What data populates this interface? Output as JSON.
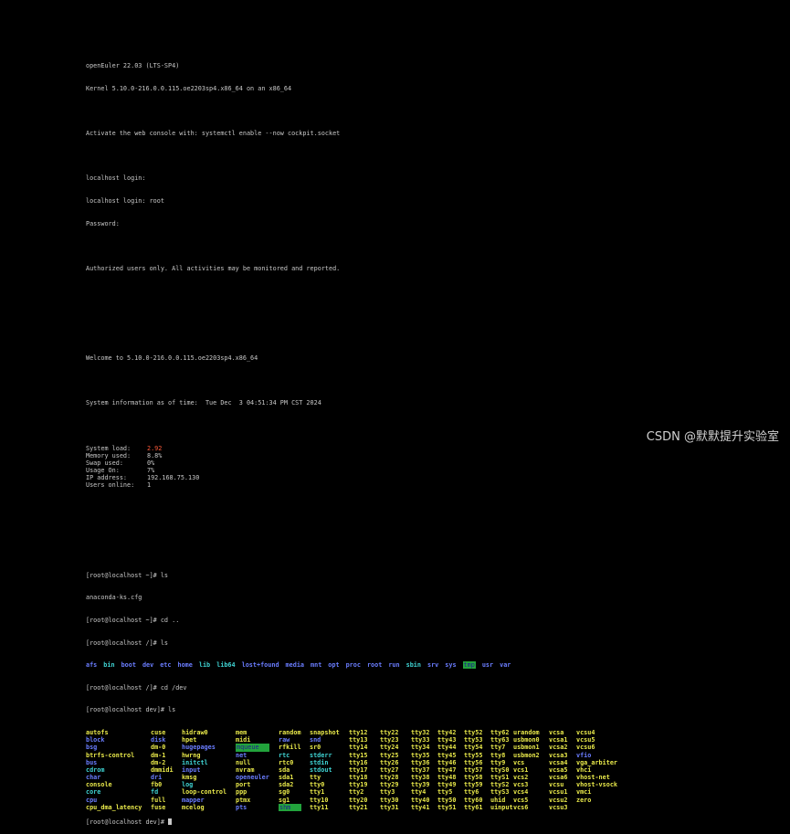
{
  "colors": {
    "default": "#c8c8c8",
    "dir": "#6a7dff",
    "cyan": "#3fd3d3",
    "yellow": "#e8e84a",
    "red": "#ff5a3a",
    "highlight_bg": "#22a33c",
    "highlight_fg": "#1f1f8f"
  },
  "header": [
    "openEuler 22.03 (LTS-SP4)",
    "Kernel 5.10.0-216.0.0.115.oe2203sp4.x86_64 on an x86_64"
  ],
  "cockpit_msg": "Activate the web console with: systemctl enable --now cockpit.socket",
  "login_lines": [
    "localhost login:",
    "localhost login: root",
    "Password:"
  ],
  "auth_msg": "Authorized users only. All activities may be monitored and reported.",
  "welcome_msg": "Welcome to 5.10.0-216.0.0.115.oe2203sp4.x86_64",
  "sysinfo_time": "System information as of time:  Tue Dec  3 04:51:34 PM CST 2024",
  "stats": [
    {
      "label": "System load:",
      "value": "2.92",
      "alert": true
    },
    {
      "label": "Memory used:",
      "value": "8.8%",
      "alert": false
    },
    {
      "label": "Swap used:",
      "value": "0%",
      "alert": false
    },
    {
      "label": "Usage On:",
      "value": "7%",
      "alert": false
    },
    {
      "label": "IP address:",
      "value": "192.168.75.130",
      "alert": false
    },
    {
      "label": "Users online:",
      "value": "1",
      "alert": false
    }
  ],
  "session": [
    {
      "text": "[root@localhost ~]# ls"
    },
    {
      "text": "anaconda-ks.cfg"
    },
    {
      "text": "[root@localhost ~]# cd .."
    },
    {
      "text": "[root@localhost /]# ls"
    }
  ],
  "ls_root": [
    {
      "name": "afs",
      "style": "dir"
    },
    {
      "name": "bin",
      "style": "cyan"
    },
    {
      "name": "boot",
      "style": "dir"
    },
    {
      "name": "dev",
      "style": "dir"
    },
    {
      "name": "etc",
      "style": "dir"
    },
    {
      "name": "home",
      "style": "dir"
    },
    {
      "name": "lib",
      "style": "cyan"
    },
    {
      "name": "lib64",
      "style": "cyan"
    },
    {
      "name": "lost+found",
      "style": "dir"
    },
    {
      "name": "media",
      "style": "dir"
    },
    {
      "name": "mnt",
      "style": "dir"
    },
    {
      "name": "opt",
      "style": "dir"
    },
    {
      "name": "proc",
      "style": "dir"
    },
    {
      "name": "root",
      "style": "dir"
    },
    {
      "name": "run",
      "style": "dir"
    },
    {
      "name": "sbin",
      "style": "cyan"
    },
    {
      "name": "srv",
      "style": "dir"
    },
    {
      "name": "sys",
      "style": "dir"
    },
    {
      "name": "tmp",
      "style": "highlight"
    },
    {
      "name": "usr",
      "style": "dir"
    },
    {
      "name": "var",
      "style": "dir"
    }
  ],
  "cd_dev": "[root@localhost /]# cd /dev",
  "ls_dev_cmd": "[root@localhost dev]# ls",
  "ls_dev": [
    [
      {
        "name": "autofs",
        "style": "yellow"
      },
      {
        "name": "block",
        "style": "dir"
      },
      {
        "name": "bsg",
        "style": "dir"
      },
      {
        "name": "btrfs-control",
        "style": "yellow"
      },
      {
        "name": "bus",
        "style": "dir"
      },
      {
        "name": "cdrom",
        "style": "cyan"
      },
      {
        "name": "char",
        "style": "dir"
      },
      {
        "name": "console",
        "style": "yellow"
      },
      {
        "name": "core",
        "style": "cyan"
      },
      {
        "name": "cpu",
        "style": "dir"
      },
      {
        "name": "cpu_dma_latency",
        "style": "yellow"
      }
    ],
    [
      {
        "name": "cuse",
        "style": "yellow"
      },
      {
        "name": "disk",
        "style": "dir"
      },
      {
        "name": "dm-0",
        "style": "yellow"
      },
      {
        "name": "dm-1",
        "style": "yellow"
      },
      {
        "name": "dm-2",
        "style": "yellow"
      },
      {
        "name": "dmmidi",
        "style": "yellow"
      },
      {
        "name": "dri",
        "style": "dir"
      },
      {
        "name": "fb0",
        "style": "yellow"
      },
      {
        "name": "fd",
        "style": "cyan"
      },
      {
        "name": "full",
        "style": "yellow"
      },
      {
        "name": "fuse",
        "style": "yellow"
      }
    ],
    [
      {
        "name": "hidraw0",
        "style": "yellow"
      },
      {
        "name": "hpet",
        "style": "yellow"
      },
      {
        "name": "hugepages",
        "style": "dir"
      },
      {
        "name": "hwrng",
        "style": "yellow"
      },
      {
        "name": "initctl",
        "style": "cyan"
      },
      {
        "name": "input",
        "style": "dir"
      },
      {
        "name": "kmsg",
        "style": "yellow"
      },
      {
        "name": "log",
        "style": "cyan"
      },
      {
        "name": "loop-control",
        "style": "yellow"
      },
      {
        "name": "mapper",
        "style": "dir"
      },
      {
        "name": "mcelog",
        "style": "yellow"
      }
    ],
    [
      {
        "name": "mem",
        "style": "yellow"
      },
      {
        "name": "midi",
        "style": "yellow"
      },
      {
        "name": "mqueue",
        "style": "highlight"
      },
      {
        "name": "net",
        "style": "dir"
      },
      {
        "name": "null",
        "style": "yellow"
      },
      {
        "name": "nvram",
        "style": "yellow"
      },
      {
        "name": "openeuler",
        "style": "dir"
      },
      {
        "name": "port",
        "style": "yellow"
      },
      {
        "name": "ppp",
        "style": "yellow"
      },
      {
        "name": "ptmx",
        "style": "yellow"
      },
      {
        "name": "pts",
        "style": "dir"
      }
    ],
    [
      {
        "name": "random",
        "style": "yellow"
      },
      {
        "name": "raw",
        "style": "dir"
      },
      {
        "name": "rfkill",
        "style": "yellow"
      },
      {
        "name": "rtc",
        "style": "cyan"
      },
      {
        "name": "rtc0",
        "style": "yellow"
      },
      {
        "name": "sda",
        "style": "yellow"
      },
      {
        "name": "sda1",
        "style": "yellow"
      },
      {
        "name": "sda2",
        "style": "yellow"
      },
      {
        "name": "sg0",
        "style": "yellow"
      },
      {
        "name": "sg1",
        "style": "yellow"
      },
      {
        "name": "shm",
        "style": "highlight"
      }
    ],
    [
      {
        "name": "snapshot",
        "style": "yellow"
      },
      {
        "name": "snd",
        "style": "dir"
      },
      {
        "name": "sr0",
        "style": "yellow"
      },
      {
        "name": "stderr",
        "style": "cyan"
      },
      {
        "name": "stdin",
        "style": "cyan"
      },
      {
        "name": "stdout",
        "style": "cyan"
      },
      {
        "name": "tty",
        "style": "yellow"
      },
      {
        "name": "tty0",
        "style": "yellow"
      },
      {
        "name": "tty1",
        "style": "yellow"
      },
      {
        "name": "tty10",
        "style": "yellow"
      },
      {
        "name": "tty11",
        "style": "yellow"
      }
    ],
    [
      {
        "name": "tty12",
        "style": "yellow"
      },
      {
        "name": "tty13",
        "style": "yellow"
      },
      {
        "name": "tty14",
        "style": "yellow"
      },
      {
        "name": "tty15",
        "style": "yellow"
      },
      {
        "name": "tty16",
        "style": "yellow"
      },
      {
        "name": "tty17",
        "style": "yellow"
      },
      {
        "name": "tty18",
        "style": "yellow"
      },
      {
        "name": "tty19",
        "style": "yellow"
      },
      {
        "name": "tty2",
        "style": "yellow"
      },
      {
        "name": "tty20",
        "style": "yellow"
      },
      {
        "name": "tty21",
        "style": "yellow"
      }
    ],
    [
      {
        "name": "tty22",
        "style": "yellow"
      },
      {
        "name": "tty23",
        "style": "yellow"
      },
      {
        "name": "tty24",
        "style": "yellow"
      },
      {
        "name": "tty25",
        "style": "yellow"
      },
      {
        "name": "tty26",
        "style": "yellow"
      },
      {
        "name": "tty27",
        "style": "yellow"
      },
      {
        "name": "tty28",
        "style": "yellow"
      },
      {
        "name": "tty29",
        "style": "yellow"
      },
      {
        "name": "tty3",
        "style": "yellow"
      },
      {
        "name": "tty30",
        "style": "yellow"
      },
      {
        "name": "tty31",
        "style": "yellow"
      }
    ],
    [
      {
        "name": "tty32",
        "style": "yellow"
      },
      {
        "name": "tty33",
        "style": "yellow"
      },
      {
        "name": "tty34",
        "style": "yellow"
      },
      {
        "name": "tty35",
        "style": "yellow"
      },
      {
        "name": "tty36",
        "style": "yellow"
      },
      {
        "name": "tty37",
        "style": "yellow"
      },
      {
        "name": "tty38",
        "style": "yellow"
      },
      {
        "name": "tty39",
        "style": "yellow"
      },
      {
        "name": "tty4",
        "style": "yellow"
      },
      {
        "name": "tty40",
        "style": "yellow"
      },
      {
        "name": "tty41",
        "style": "yellow"
      }
    ],
    [
      {
        "name": "tty42",
        "style": "yellow"
      },
      {
        "name": "tty43",
        "style": "yellow"
      },
      {
        "name": "tty44",
        "style": "yellow"
      },
      {
        "name": "tty45",
        "style": "yellow"
      },
      {
        "name": "tty46",
        "style": "yellow"
      },
      {
        "name": "tty47",
        "style": "yellow"
      },
      {
        "name": "tty48",
        "style": "yellow"
      },
      {
        "name": "tty49",
        "style": "yellow"
      },
      {
        "name": "tty5",
        "style": "yellow"
      },
      {
        "name": "tty50",
        "style": "yellow"
      },
      {
        "name": "tty51",
        "style": "yellow"
      }
    ],
    [
      {
        "name": "tty52",
        "style": "yellow"
      },
      {
        "name": "tty53",
        "style": "yellow"
      },
      {
        "name": "tty54",
        "style": "yellow"
      },
      {
        "name": "tty55",
        "style": "yellow"
      },
      {
        "name": "tty56",
        "style": "yellow"
      },
      {
        "name": "tty57",
        "style": "yellow"
      },
      {
        "name": "tty58",
        "style": "yellow"
      },
      {
        "name": "tty59",
        "style": "yellow"
      },
      {
        "name": "tty6",
        "style": "yellow"
      },
      {
        "name": "tty60",
        "style": "yellow"
      },
      {
        "name": "tty61",
        "style": "yellow"
      }
    ],
    [
      {
        "name": "tty62",
        "style": "yellow"
      },
      {
        "name": "tty63",
        "style": "yellow"
      },
      {
        "name": "tty7",
        "style": "yellow"
      },
      {
        "name": "tty8",
        "style": "yellow"
      },
      {
        "name": "tty9",
        "style": "yellow"
      },
      {
        "name": "ttyS0",
        "style": "yellow"
      },
      {
        "name": "ttyS1",
        "style": "yellow"
      },
      {
        "name": "ttyS2",
        "style": "yellow"
      },
      {
        "name": "ttyS3",
        "style": "yellow"
      },
      {
        "name": "uhid",
        "style": "yellow"
      },
      {
        "name": "uinput",
        "style": "yellow"
      }
    ],
    [
      {
        "name": "urandom",
        "style": "yellow"
      },
      {
        "name": "usbmon0",
        "style": "yellow"
      },
      {
        "name": "usbmon1",
        "style": "yellow"
      },
      {
        "name": "usbmon2",
        "style": "yellow"
      },
      {
        "name": "vcs",
        "style": "yellow"
      },
      {
        "name": "vcs1",
        "style": "yellow"
      },
      {
        "name": "vcs2",
        "style": "yellow"
      },
      {
        "name": "vcs3",
        "style": "yellow"
      },
      {
        "name": "vcs4",
        "style": "yellow"
      },
      {
        "name": "vcs5",
        "style": "yellow"
      },
      {
        "name": "vcs6",
        "style": "yellow"
      }
    ],
    [
      {
        "name": "vcsa",
        "style": "yellow"
      },
      {
        "name": "vcsa1",
        "style": "yellow"
      },
      {
        "name": "vcsa2",
        "style": "yellow"
      },
      {
        "name": "vcsa3",
        "style": "yellow"
      },
      {
        "name": "vcsa4",
        "style": "yellow"
      },
      {
        "name": "vcsa5",
        "style": "yellow"
      },
      {
        "name": "vcsa6",
        "style": "yellow"
      },
      {
        "name": "vcsu",
        "style": "yellow"
      },
      {
        "name": "vcsu1",
        "style": "yellow"
      },
      {
        "name": "vcsu2",
        "style": "yellow"
      },
      {
        "name": "vcsu3",
        "style": "yellow"
      }
    ],
    [
      {
        "name": "vcsu4",
        "style": "yellow"
      },
      {
        "name": "vcsu5",
        "style": "yellow"
      },
      {
        "name": "vcsu6",
        "style": "yellow"
      },
      {
        "name": "vfio",
        "style": "dir"
      },
      {
        "name": "vga_arbiter",
        "style": "yellow"
      },
      {
        "name": "vhci",
        "style": "yellow"
      },
      {
        "name": "vhost-net",
        "style": "yellow"
      },
      {
        "name": "vhost-vsock",
        "style": "yellow"
      },
      {
        "name": "vmci",
        "style": "yellow"
      },
      {
        "name": "zero",
        "style": "yellow"
      }
    ]
  ],
  "final_prompt": "[root@localhost dev]# ",
  "watermark": "CSDN @默默提升实验室"
}
